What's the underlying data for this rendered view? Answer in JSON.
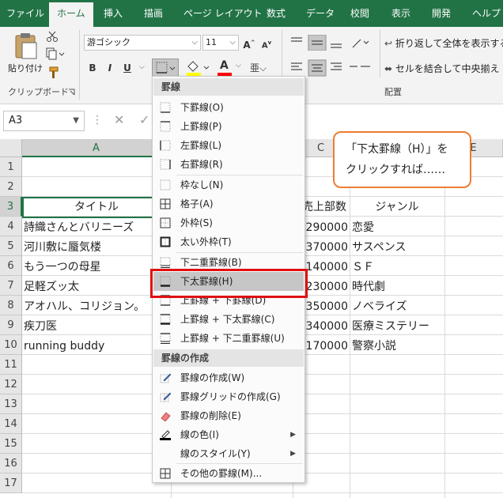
{
  "tabs": [
    {
      "label": "ファイル",
      "active": false
    },
    {
      "label": "ホーム",
      "active": true
    },
    {
      "label": "挿入",
      "active": false
    },
    {
      "label": "描画",
      "active": false
    },
    {
      "label": "ページ レイアウト",
      "active": false
    },
    {
      "label": "数式",
      "active": false
    },
    {
      "label": "データ",
      "active": false
    },
    {
      "label": "校閲",
      "active": false
    },
    {
      "label": "表示",
      "active": false
    },
    {
      "label": "開発",
      "active": false
    },
    {
      "label": "ヘルプ",
      "active": false
    }
  ],
  "ribbon": {
    "paste_label": "貼り付け",
    "clipboard_group": "クリップボード",
    "font_name": "游ゴシック",
    "font_size": "11",
    "grow_font": "A",
    "shrink_font": "A",
    "bold": "B",
    "italic": "I",
    "underline": "U",
    "font_color_letter": "A",
    "wrap_text": "折り返して全体を表示する",
    "merge_center": "セルを結合して中央揃え",
    "alignment_group": "配置",
    "accent_font_color": "#ff0000",
    "accent_fill_color": "#ffff00"
  },
  "formula_bar": {
    "name_box": "A3",
    "cancel_icon": "✕",
    "enter_icon": "✓"
  },
  "grid": {
    "columns": [
      "A",
      "C",
      "E"
    ],
    "rows": [
      "1",
      "2",
      "3",
      "4",
      "5",
      "6",
      "7",
      "8",
      "9",
      "10",
      "11",
      "12",
      "13",
      "14",
      "15",
      "16",
      "17"
    ],
    "header_sales": "売上部数",
    "header_genre": "ジャンル",
    "records": [
      {
        "row": "3",
        "title": "タイトル",
        "sales": "",
        "genre": ""
      },
      {
        "row": "4",
        "title": "詩織さんとバリニーズ",
        "sales": "290000",
        "genre": "恋愛"
      },
      {
        "row": "5",
        "title": "河川敷に蜃気楼",
        "sales": "370000",
        "genre": "サスペンス"
      },
      {
        "row": "6",
        "title": "もう一つの母星",
        "sales": "140000",
        "genre": "ＳＦ"
      },
      {
        "row": "7",
        "title": "足軽ズッ太",
        "sales": "230000",
        "genre": "時代劇"
      },
      {
        "row": "8",
        "title": "アオハル、コリジョン。",
        "sales": "350000",
        "genre": "ノベライズ"
      },
      {
        "row": "9",
        "title": "疾刀医",
        "sales": "340000",
        "genre": "医療ミステリー"
      },
      {
        "row": "10",
        "title": "running buddy",
        "sales": "170000",
        "genre": "警察小説"
      }
    ]
  },
  "callout": {
    "line1": "「下太罫線（H）」を",
    "line2": "クリックすれば……"
  },
  "menu": {
    "section1": "罫線",
    "section2": "罫線の作成",
    "items": [
      {
        "label": "下罫線(O)",
        "icon": "bottom-border-icon"
      },
      {
        "label": "上罫線(P)",
        "icon": "top-border-icon"
      },
      {
        "label": "左罫線(L)",
        "icon": "left-border-icon"
      },
      {
        "label": "右罫線(R)",
        "icon": "right-border-icon"
      },
      {
        "label": "枠なし(N)",
        "icon": "no-border-icon"
      },
      {
        "label": "格子(A)",
        "icon": "all-borders-icon"
      },
      {
        "label": "外枠(S)",
        "icon": "outside-borders-icon"
      },
      {
        "label": "太い外枠(T)",
        "icon": "thick-outside-border-icon"
      },
      {
        "label": "下二重罫線(B)",
        "icon": "double-bottom-border-icon"
      },
      {
        "label": "下太罫線(H)",
        "icon": "thick-bottom-border-icon"
      },
      {
        "label": "上罫線 + 下罫線(D)",
        "icon": "top-bottom-border-icon"
      },
      {
        "label": "上罫線 + 下太罫線(C)",
        "icon": "top-thick-bottom-border-icon"
      },
      {
        "label": "上罫線 + 下二重罫線(U)",
        "icon": "top-double-bottom-border-icon"
      }
    ],
    "draw_items": [
      {
        "label": "罫線の作成(W)",
        "icon": "draw-border-icon"
      },
      {
        "label": "罫線グリッドの作成(G)",
        "icon": "draw-border-grid-icon"
      },
      {
        "label": "罫線の削除(E)",
        "icon": "eraser-icon"
      },
      {
        "label": "線の色(I)",
        "icon": "line-color-icon"
      },
      {
        "label": "線のスタイル(Y)",
        "icon": "line-style-icon"
      },
      {
        "label": "その他の罫線(M)...",
        "icon": "more-borders-icon"
      }
    ],
    "highlight_color": "#e01010"
  }
}
